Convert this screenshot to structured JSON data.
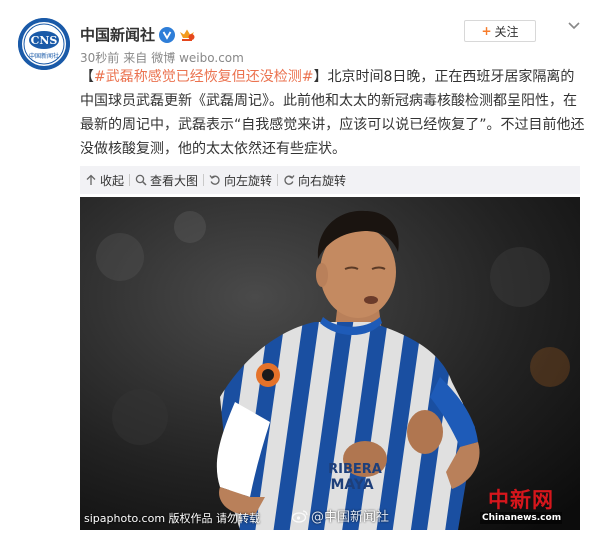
{
  "post": {
    "author": {
      "name": "中国新闻社",
      "avatar_text": "CNS",
      "avatar_subtext": "中国新闻社",
      "verified": true
    },
    "meta": {
      "time": "30秒前",
      "source_prefix": "来自",
      "source": "微博 weibo.com"
    },
    "follow_label": "关注",
    "text": {
      "open_bracket": "【",
      "hashtag": "#武磊称感觉已经恢复但还没检测#",
      "close_bracket": "】",
      "body": "北京时间8日晚，正在西班牙居家隔离的中国球员武磊更新《武磊周记》。此前他和太太的新冠病毒核酸检测都呈阳性，在最新的周记中，武磊表示“自我感觉来讲，应该可以说已经恢复了”。不过目前他还没做核酸复测，他的太太依然还有些症状。"
    },
    "toolbar": {
      "collapse": "收起",
      "view_large": "查看大图",
      "rotate_left": "向左旋转",
      "rotate_right": "向右旋转"
    },
    "photo": {
      "watermark_left": "sipaphoto.com 版权作品 请勿转载",
      "watermark_center": "@中国新闻社",
      "watermark_logo_cn": "中新网",
      "watermark_logo_en": "Chinanews.com",
      "jersey_text_1": "RIBERA",
      "jersey_text_2": "MAYA"
    }
  },
  "colors": {
    "hashtag": "#eb7350",
    "follow_plus": "#f77c2b",
    "toolbar_bg": "#f2f2f5",
    "verified_badge": "#2e7ed8",
    "avatar_bg": "#1a5aa8",
    "jersey_blue": "#1e5bb8",
    "logo_red": "#d6161c"
  },
  "icons": {
    "verified": "verified-v-icon",
    "member": "crown-icon",
    "more": "chevron-down-icon",
    "collapse": "arrow-up-icon",
    "view_large": "magnifier-icon",
    "rotate_left": "rotate-left-icon",
    "rotate_right": "rotate-right-icon"
  }
}
